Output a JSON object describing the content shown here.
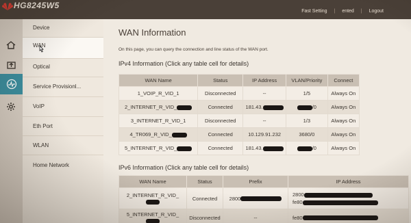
{
  "header": {
    "model": "HG8245W5",
    "links": [
      "Fast Setting",
      "ented",
      "Logout"
    ]
  },
  "menu": {
    "items": [
      "Device",
      "WAN",
      "Optical",
      "Service Provisionl...",
      "VoIP",
      "Eth Port",
      "WLAN",
      "Home Network"
    ],
    "active": "WAN"
  },
  "page": {
    "title": "WAN Information",
    "description": "On this page, you can query the connection and line status of the WAN port."
  },
  "ipv4": {
    "heading": "IPv4 Information (Click any table cell for details)",
    "columns": [
      "WAN Name",
      "Status",
      "IP Address",
      "VLAN/Priority",
      "Connect"
    ],
    "rows": [
      {
        "name": "1_VOIP_R_VID_1",
        "status": "Disconnected",
        "ip": "--",
        "vlan": "1/5",
        "connect": "Always On"
      },
      {
        "name": "2_INTERNET_R_VID_",
        "status": "Connected",
        "ip": "181.43.",
        "vlan": "/0",
        "connect": "Always On"
      },
      {
        "name": "3_INTERNET_R_VID_1",
        "status": "Disconnected",
        "ip": "--",
        "vlan": "1/3",
        "connect": "Always On"
      },
      {
        "name": "4_TR069_R_VID_",
        "status": "Connected",
        "ip": "10.129.91.232",
        "vlan": "3680/0",
        "connect": "Always On"
      },
      {
        "name": "5_INTERNET_R_VID_",
        "status": "Connected",
        "ip": "181.43.",
        "vlan": "/0",
        "connect": "Always On"
      }
    ]
  },
  "ipv6": {
    "heading": "IPv6 Information (Click any table cell for details)",
    "columns": [
      "WAN Name",
      "Status",
      "Prefix",
      "IP Address"
    ],
    "rows": [
      {
        "name": "2_INTERNET_R_VID_",
        "status": "Connected",
        "prefix": "2800",
        "ip1": "2800",
        "ip2": "fe80"
      },
      {
        "name": "5_INTERNET_R_VID_",
        "status": "Disconnected",
        "prefix": "--",
        "ip1": "fe80",
        "ip2": ""
      }
    ]
  },
  "icons": [
    "home-icon",
    "upload-icon",
    "pulse-icon",
    "gear-icon"
  ],
  "colors": {
    "topbar": "#4a4038",
    "active_icon": "#3b8fa0",
    "table_header": "#c9bfb3"
  }
}
